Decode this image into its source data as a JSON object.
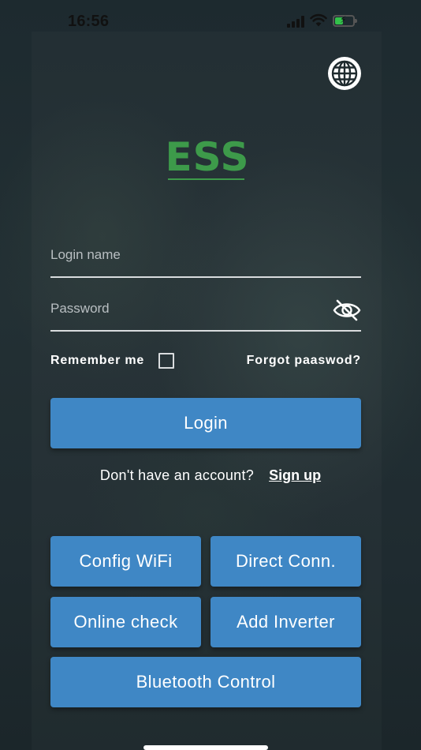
{
  "status_bar": {
    "time": "16:56",
    "battery_color": "#33c04a"
  },
  "header": {
    "language_icon": "globe-icon"
  },
  "logo": {
    "text": "ESS",
    "color": "#3d9a4a"
  },
  "form": {
    "login_placeholder": "Login name",
    "login_value": "",
    "password_placeholder": "Password",
    "password_value": "",
    "password_toggle_icon": "eye-slash-icon",
    "remember_label": "Remember me",
    "remember_checked": false,
    "forgot_label": "Forgot paaswod?",
    "login_button": "Login"
  },
  "signup": {
    "prompt": "Don't have an account?",
    "link": "Sign up"
  },
  "actions": {
    "config_wifi": "Config WiFi",
    "direct_conn": "Direct Conn.",
    "online_check": "Online check",
    "add_inverter": "Add Inverter",
    "bluetooth_control": "Bluetooth Control"
  },
  "colors": {
    "button": "#3f87c5",
    "background": "#1e2a2e"
  }
}
